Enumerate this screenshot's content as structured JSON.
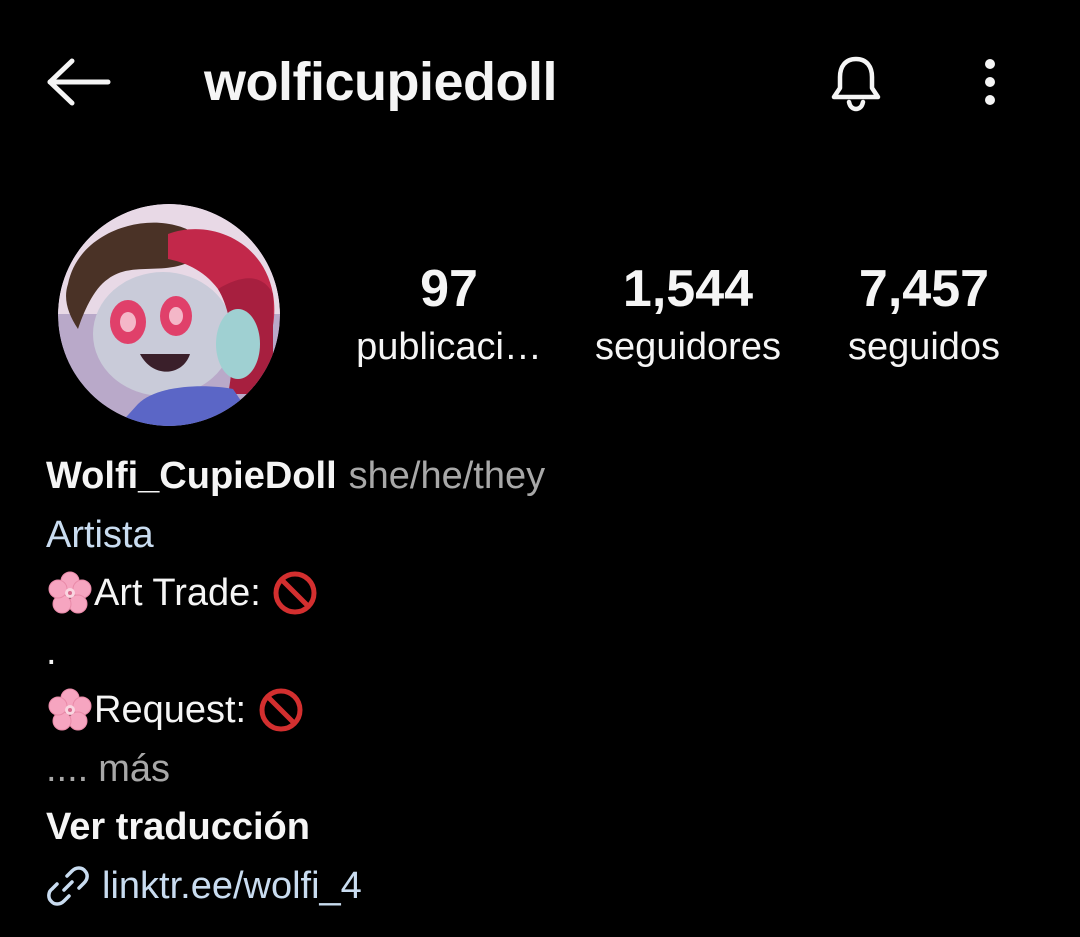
{
  "header": {
    "username": "wolficupiedoll"
  },
  "stats": {
    "posts_count": "97",
    "posts_label": "publicaci…",
    "followers_count": "1,544",
    "followers_label": "seguidores",
    "following_count": "7,457",
    "following_label": "seguidos"
  },
  "bio": {
    "display_name": "Wolfi_CupieDoll",
    "pronouns": "she/he/they",
    "category": "Artista",
    "line_art_trade": "Art Trade: ",
    "line_dot": ".",
    "line_request": "Request: ",
    "ellipsis": "....",
    "more_label": "más",
    "translate_label": "Ver traducción",
    "link_text": "linktr.ee/wolfi_4"
  },
  "icons": {
    "back": "arrow-left-icon",
    "bell": "bell-icon",
    "more": "more-vertical-icon",
    "flower": "cherry-blossom-icon",
    "prohibited": "prohibited-icon",
    "link": "link-icon"
  },
  "colors": {
    "background": "#000000",
    "text": "#f5f5f5",
    "muted": "#a8a8a8",
    "link": "#c9dcf0",
    "prohibited_red": "#d32f2f",
    "blossom_pink": "#f6a5c0"
  }
}
